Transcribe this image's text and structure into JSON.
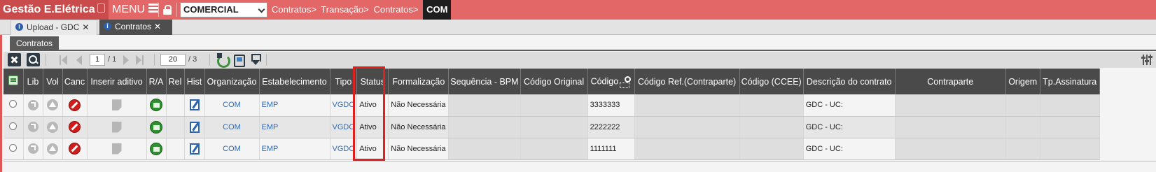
{
  "app": {
    "title": "Gestão E.Elétrica",
    "menu_label": "MENU"
  },
  "module": {
    "selected": "COMERCIAL"
  },
  "breadcrumb": {
    "items": [
      "Contratos>",
      "Transação>",
      "Contratos>"
    ],
    "current": "COM"
  },
  "tabs": [
    {
      "label": "Upload - GDC",
      "close": "✕"
    },
    {
      "label": "Contratos",
      "close": "✕"
    }
  ],
  "panel": {
    "title": "Contratos"
  },
  "toolbar": {
    "page": "1",
    "page_total": "/ 1",
    "page_size": "20",
    "record_total": "/ 3"
  },
  "columns": [
    "Lib",
    "Vol",
    "Canc",
    "Inserir aditivo",
    "R/A",
    "Rel",
    "Hist",
    "Organização",
    "Estabelecimento",
    "Tipo",
    "Status",
    "Formalização",
    "Sequência - BPM",
    "Código Original",
    "Código",
    "Código Ref.(Contraparte)",
    "Código (CCEE)",
    "Descrição do contrato",
    "Contraparte",
    "Origem",
    "Tp.Assinatura"
  ],
  "rows": [
    {
      "organizacao": "COM",
      "estabelecimento": "EMP",
      "tipo": "VGDC",
      "status": "Ativo",
      "formalizacao": "Não Necessária",
      "codigo": "3333333",
      "descricao": "GDC - UC:"
    },
    {
      "organizacao": "COM",
      "estabelecimento": "EMP",
      "tipo": "VGDC",
      "status": "Ativo",
      "formalizacao": "Não Necessária",
      "codigo": "2222222",
      "descricao": "GDC - UC:"
    },
    {
      "organizacao": "COM",
      "estabelecimento": "EMP",
      "tipo": "VGDC",
      "status": "Ativo",
      "formalizacao": "Não Necessária",
      "codigo": "1111111",
      "descricao": "GDC - UC:"
    }
  ],
  "colors": {
    "topbar": "#e36767",
    "title_bg": "#c94b4b",
    "header_bg": "#4a4a4a",
    "link": "#2f6bb5",
    "highlight": "#e01f1f"
  }
}
